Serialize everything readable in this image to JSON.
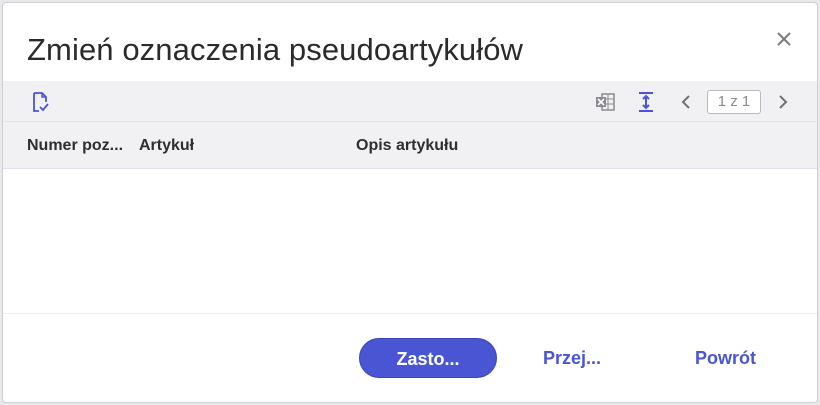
{
  "dialog": {
    "title": "Zmień oznaczenia pseudoartykułów",
    "close_icon": "close-icon"
  },
  "toolbar": {
    "left_icon": "document-check-icon",
    "excel_icon": "excel-export-icon",
    "fit_height_icon": "fit-height-icon",
    "prev_icon": "chevron-left-icon",
    "pager_text": "1 z 1",
    "next_icon": "chevron-right-icon",
    "accent_color": "#4a55d4"
  },
  "table": {
    "columns": [
      "Numer poz...",
      "Artykuł",
      "Opis artykułu"
    ],
    "rows": []
  },
  "footer": {
    "apply_label": "Zasto...",
    "move_label": "Przej...",
    "back_label": "Powrót"
  }
}
